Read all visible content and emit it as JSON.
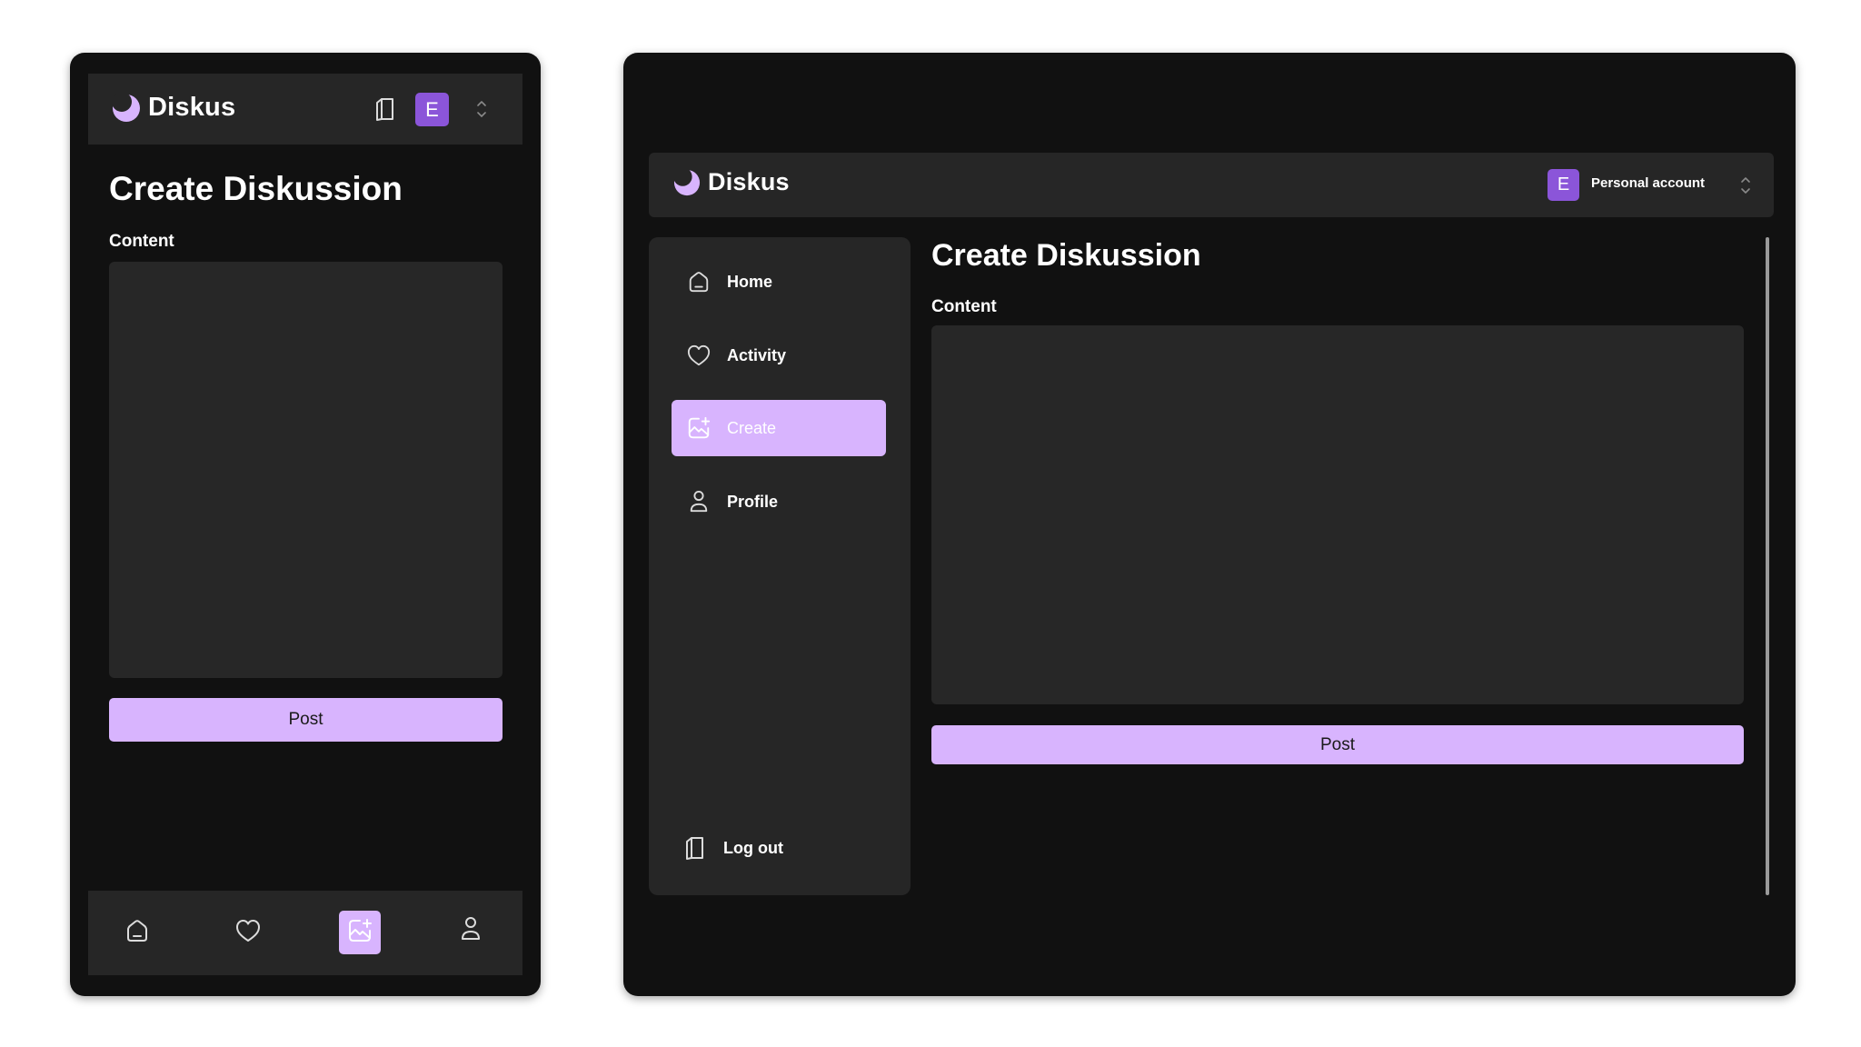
{
  "app": {
    "name": "Diskus"
  },
  "colors": {
    "accent": "#D8B4FE",
    "avatar": "#8B55D9",
    "surface": "#262626",
    "background": "#111111",
    "field": "#272727"
  },
  "account": {
    "initial": "E",
    "name": "Personal account"
  },
  "page": {
    "title": "Create Diskussion",
    "content_label": "Content",
    "post_label": "Post"
  },
  "nav": {
    "items": [
      {
        "label": "Home",
        "icon": "home-icon"
      },
      {
        "label": "Activity",
        "icon": "heart-icon"
      },
      {
        "label": "Create",
        "icon": "create-post-icon",
        "active": true
      },
      {
        "label": "Profile",
        "icon": "user-icon"
      }
    ],
    "logout_label": "Log out"
  },
  "mobile_tabs": [
    "home-icon",
    "heart-icon",
    "create-post-icon",
    "user-icon"
  ]
}
